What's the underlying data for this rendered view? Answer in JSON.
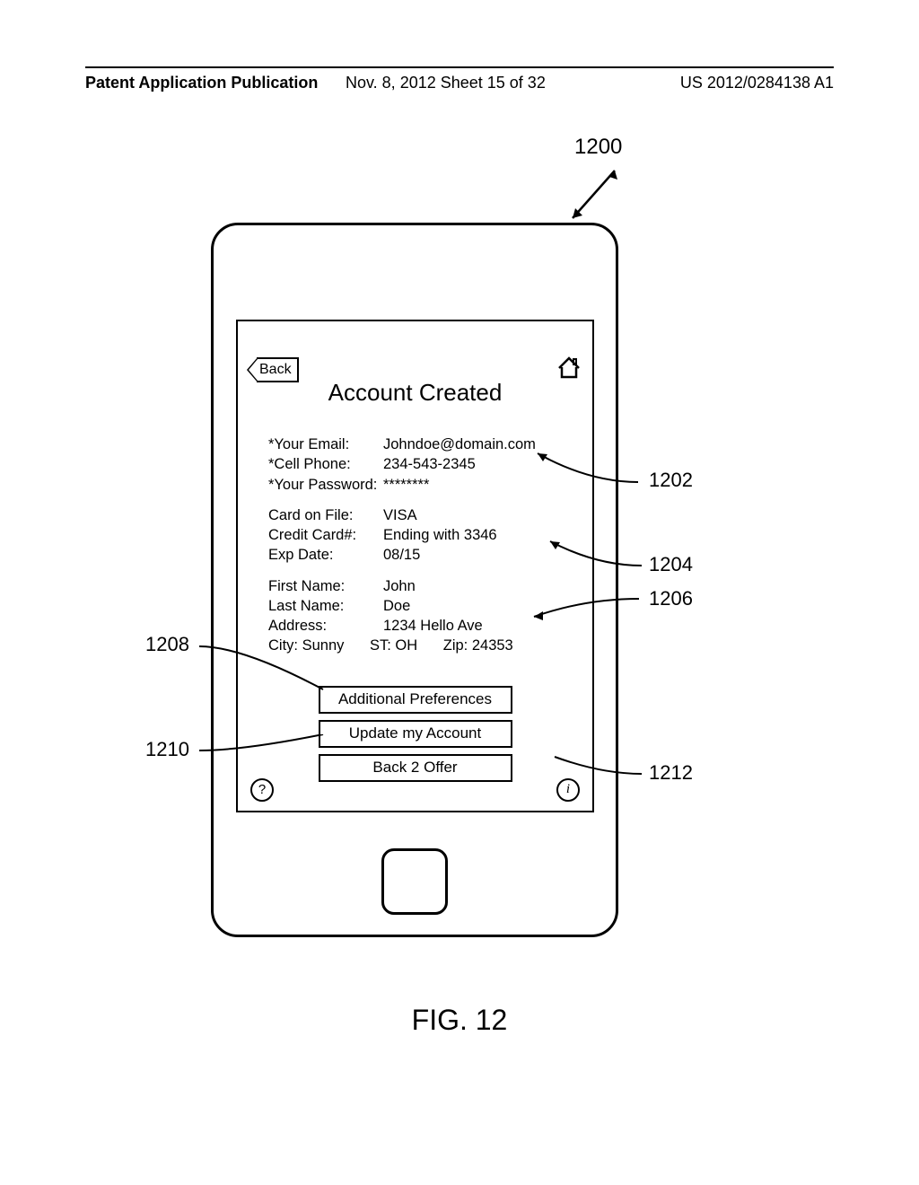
{
  "header": {
    "left": "Patent Application Publication",
    "mid": "Nov. 8, 2012  Sheet 15 of 32",
    "right": "US 2012/0284138 A1"
  },
  "refs": {
    "r1200": "1200",
    "r1202": "1202",
    "r1204": "1204",
    "r1206": "1206",
    "r1208": "1208",
    "r1210": "1210",
    "r1212": "1212"
  },
  "screen": {
    "back_label": "Back",
    "title": "Account Created",
    "email_label": "*Your Email:",
    "email_value": "Johndoe@domain.com",
    "cell_label": "*Cell Phone:",
    "cell_value": "234-543-2345",
    "pwd_label": "*Your Password:",
    "pwd_value": "********",
    "cardfile_label": "Card on File:",
    "cardfile_value": "VISA",
    "ccnum_label": "Credit Card#:",
    "ccnum_value": "Ending with 3346",
    "exp_label": "Exp Date:",
    "exp_value": "08/15",
    "fname_label": "First Name:",
    "fname_value": "John",
    "lname_label": "Last Name:",
    "lname_value": "Doe",
    "addr_label": "Address:",
    "addr_value": "1234 Hello Ave",
    "city_label": "City: Sunny",
    "state_label": "ST:  OH",
    "zip_label": "Zip: 24353",
    "btn_prefs": "Additional Preferences",
    "btn_update": "Update my Account",
    "btn_back2": "Back 2 Offer",
    "help_glyph": "?",
    "info_glyph": "i"
  },
  "figure_caption": "FIG. 12"
}
